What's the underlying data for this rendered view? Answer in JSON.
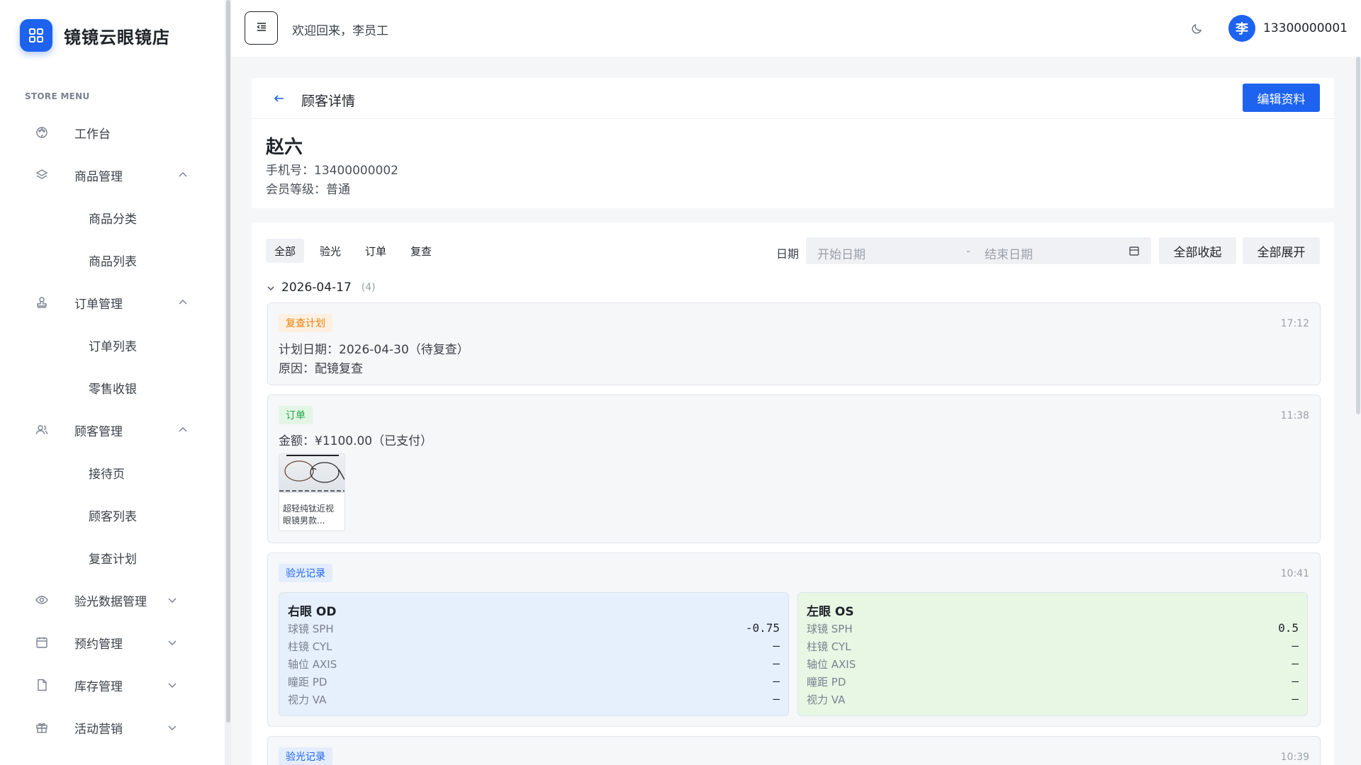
{
  "brand": {
    "name": "镜镜云眼镜店"
  },
  "menu_caption": "STORE MENU",
  "menu": [
    {
      "label": "工作台"
    },
    {
      "label": "商品管理"
    },
    {
      "label": "商品分类"
    },
    {
      "label": "商品列表"
    },
    {
      "label": "订单管理"
    },
    {
      "label": "订单列表"
    },
    {
      "label": "零售收银"
    },
    {
      "label": "顾客管理"
    },
    {
      "label": "接待页"
    },
    {
      "label": "顾客列表"
    },
    {
      "label": "复查计划"
    },
    {
      "label": "验光数据管理"
    },
    {
      "label": "预约管理"
    },
    {
      "label": "库存管理"
    },
    {
      "label": "活动营销"
    }
  ],
  "header": {
    "welcome": "欢迎回来，李员工",
    "avatar_text": "李",
    "phone": "13300000001"
  },
  "customer": {
    "page_title": "顾客详情",
    "edit_label": "编辑资料",
    "name": "赵六",
    "phone_line": "手机号：13400000002",
    "level_line": "会员等级：普通"
  },
  "timeline": {
    "filters": [
      "全部",
      "验光",
      "订单",
      "复查"
    ],
    "date_label": "日期",
    "start_placeholder": "开始日期",
    "separator": "-",
    "end_placeholder": "结束日期",
    "collapse_all": "全部收起",
    "expand_all": "全部展开",
    "group": {
      "date": "2026-04-17",
      "count": "(4)"
    },
    "records": [
      {
        "tag": "复查计划",
        "time": "17:12",
        "line1": "计划日期：2026-04-30（待复查）",
        "line2": "原因：配镜复查"
      },
      {
        "tag": "订单",
        "time": "11:38",
        "line1": "金额：¥1100.00（已支付）",
        "product_name": "超轻纯钛近视眼镜男款..."
      },
      {
        "tag": "验光记录",
        "time": "10:41",
        "od": {
          "title": "右眼 OD",
          "rows": [
            {
              "k": "球镜 SPH",
              "v": "-0.75"
            },
            {
              "k": "柱镜 CYL",
              "v": "—"
            },
            {
              "k": "轴位 AXIS",
              "v": "—"
            },
            {
              "k": "瞳距 PD",
              "v": "—"
            },
            {
              "k": "视力 VA",
              "v": "—"
            }
          ]
        },
        "os": {
          "title": "左眼 OS",
          "rows": [
            {
              "k": "球镜 SPH",
              "v": "0.5"
            },
            {
              "k": "柱镜 CYL",
              "v": "—"
            },
            {
              "k": "轴位 AXIS",
              "v": "—"
            },
            {
              "k": "瞳距 PD",
              "v": "—"
            },
            {
              "k": "视力 VA",
              "v": "—"
            }
          ]
        }
      },
      {
        "tag": "验光记录",
        "time": "10:39"
      }
    ]
  },
  "colors": {
    "primary": "#1d63f0",
    "orange": "#e8800c",
    "green": "#22a845"
  }
}
